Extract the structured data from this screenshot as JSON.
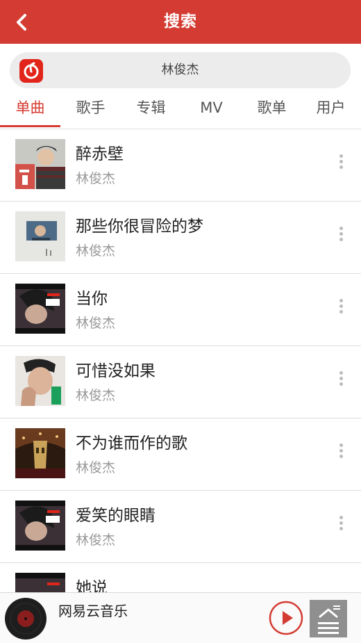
{
  "header": {
    "title": "搜索"
  },
  "search": {
    "query": "林俊杰"
  },
  "tabs": [
    {
      "label": "单曲",
      "active": true
    },
    {
      "label": "歌手"
    },
    {
      "label": "专辑"
    },
    {
      "label": "MV"
    },
    {
      "label": "歌单"
    },
    {
      "label": "用户"
    }
  ],
  "songs": [
    {
      "title": "醉赤壁",
      "artist": "林俊杰"
    },
    {
      "title": "那些你很冒险的梦",
      "artist": "林俊杰"
    },
    {
      "title": "当你",
      "artist": "林俊杰"
    },
    {
      "title": "可惜没如果",
      "artist": "林俊杰"
    },
    {
      "title": "不为谁而作的歌",
      "artist": "林俊杰"
    },
    {
      "title": "爱笑的眼睛",
      "artist": "林俊杰"
    },
    {
      "title": "她说",
      "artist": ""
    }
  ],
  "player": {
    "title": "网易云音乐"
  },
  "colors": {
    "accent": "#d43c33",
    "muted": "#999999"
  },
  "icons": {
    "back": "chevron-left-icon",
    "logo": "netease-music-logo-icon",
    "more": "more-vertical-icon",
    "play": "play-icon",
    "playlist": "playlist-icon",
    "disc": "vinyl-disc-icon"
  }
}
